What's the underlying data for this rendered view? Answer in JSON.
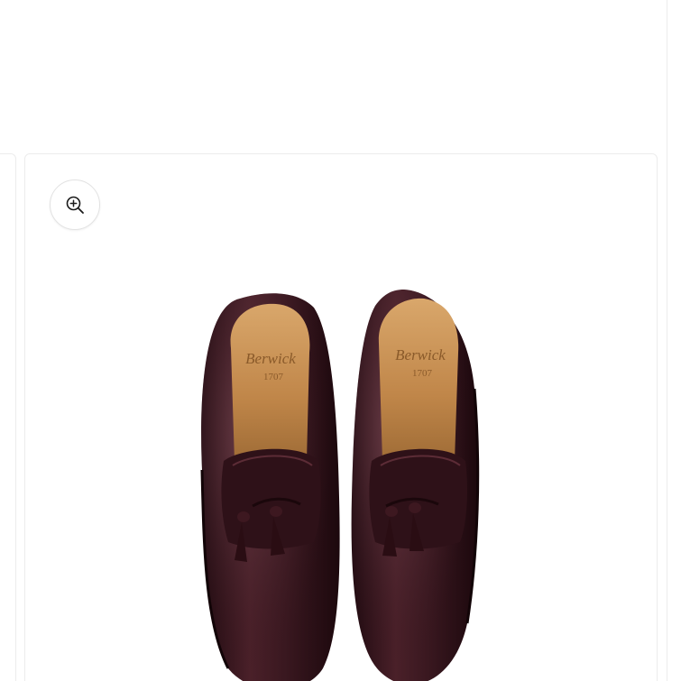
{
  "gallery": {
    "zoom_button": {
      "icon": "zoom-in-icon"
    },
    "product_image": {
      "brand_imprint": "Berwick",
      "year_imprint": "1707",
      "colors": {
        "leather": "#3b1820",
        "leather_highlight": "#6b3a44",
        "lining": "#c8955a",
        "lining_shadow": "#a9763f"
      }
    }
  }
}
